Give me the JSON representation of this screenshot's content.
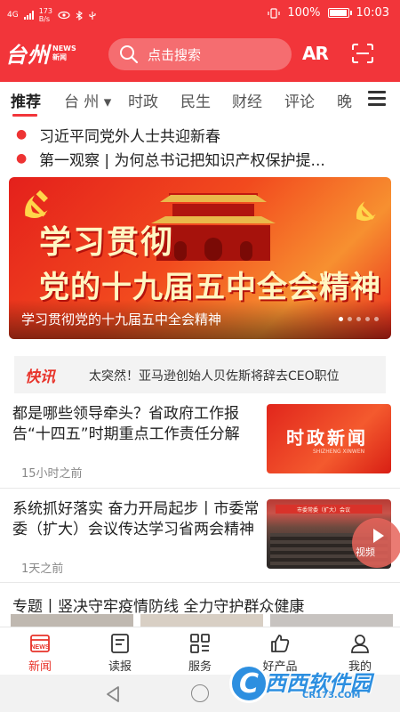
{
  "status_bar": {
    "network": "4G",
    "speed_value": "173",
    "speed_unit": "B/s",
    "battery": "100%",
    "battery_level": 1.0,
    "time": "10:03"
  },
  "header": {
    "logo_main": "台州",
    "logo_news_en": "NEWS",
    "logo_news_cn": "新闻",
    "search_placeholder": "点击搜索",
    "ar_label": "AR",
    "scan_icon": "scan-icon",
    "search_icon": "search-icon"
  },
  "tabs": [
    {
      "label": "推荐",
      "active": true
    },
    {
      "label": "台 州 ▾",
      "active": false
    },
    {
      "label": "时政",
      "active": false
    },
    {
      "label": "民生",
      "active": false
    },
    {
      "label": "财经",
      "active": false
    },
    {
      "label": "评论",
      "active": false
    },
    {
      "label": "晚",
      "active": false
    }
  ],
  "headlines": [
    "习近平同党外人士共迎新春",
    "第一观察 | 为何总书记把知识产权保护提..."
  ],
  "banner": {
    "line1": "学习贯彻",
    "line2": "党的十九届五中全会精神",
    "caption": "学习贯彻党的十九届五中全会精神",
    "slides": 5,
    "active_slide": 1
  },
  "flash": {
    "tag": "快讯",
    "text": "太突然！亚马逊创始人贝佐斯将辞去CEO职位"
  },
  "news": [
    {
      "title": "都是哪些领导牵头？省政府工作报告“十四五”时期重点工作责任分解",
      "time": "15小时之前",
      "thumb_title": "时政新闻",
      "thumb_sub": "SHIZHENG XINWEN"
    },
    {
      "title": "系统抓好落实 奋力开局起步丨市委常委（扩大）会议传达学习省两会精神",
      "time": "1天之前",
      "thumb_banner": "市委常委（扩大）会议",
      "video_label": "视频"
    }
  ],
  "topic": "专题丨竖决守牢疫情防线 全力守护群众健康",
  "bottom_nav": [
    {
      "label": "新闻",
      "icon": "news-icon",
      "active": true
    },
    {
      "label": "读报",
      "icon": "newspaper-icon",
      "active": false
    },
    {
      "label": "服务",
      "icon": "grid-icon",
      "active": false
    },
    {
      "label": "好产品",
      "icon": "thumbs-up-icon",
      "active": false
    },
    {
      "label": "我的",
      "icon": "user-icon",
      "active": false
    }
  ],
  "watermark": {
    "brand": "西西软件园",
    "url": "CR173.COM"
  },
  "colors": {
    "brand_red": "#f2353a",
    "flash_red": "#e8332a",
    "watermark_blue": "#2d8fe0"
  }
}
